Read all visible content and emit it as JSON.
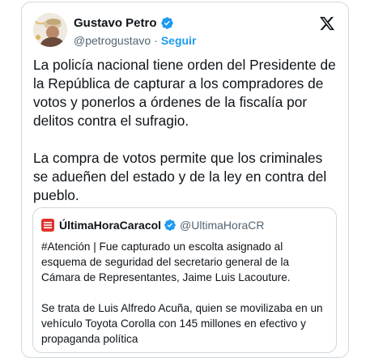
{
  "author": {
    "display_name": "Gustavo Petro",
    "handle": "@petrogustavo",
    "separator": "·",
    "follow_label": "Seguir"
  },
  "tweet": {
    "paragraphs": [
      "La policía nacional tiene orden del Presidente de la República de capturar a los compradores de votos y ponerlos a órdenes de la fiscalía por delitos contra el sufragio.",
      "La compra de votos permite que los criminales se adueñen del estado y de la ley en contra del pueblo."
    ]
  },
  "quoted_tweet": {
    "display_name": "ÚltimaHoraCaracol",
    "handle": "@UltimaHoraCR",
    "paragraphs": [
      "#Atención | Fue capturado un escolta asignado al esquema de seguridad del secretario general de la Cámara de Representantes, Jaime Luis Lacouture.",
      "Se trata de Luis Alfredo Acuña, quien se movilizaba en un vehículo Toyota Corolla con 145 millones en efectivo y propaganda política"
    ]
  },
  "icons": {
    "verified": "verified-badge-icon",
    "platform_logo": "x-logo-icon",
    "quoted_avatar": "ultimahora-logo-icon"
  },
  "colors": {
    "text_primary": "#0f1419",
    "text_secondary": "#536471",
    "accent": "#1d9bf0",
    "border": "#cfd9de",
    "quoted_brand": "#e0322b"
  }
}
